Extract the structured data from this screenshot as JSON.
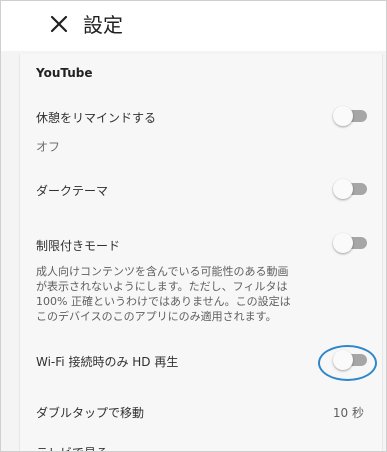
{
  "header": {
    "close_icon": "close-icon",
    "title": "設定"
  },
  "section": {
    "title": "YouTube"
  },
  "settings": {
    "remind_break": {
      "label": "休憩をリマインドする",
      "value": "オフ",
      "enabled": false
    },
    "dark_theme": {
      "label": "ダークテーマ",
      "enabled": false
    },
    "restricted_mode": {
      "label": "制限付きモード",
      "enabled": false,
      "description_lines": [
        "成人向けコンテンツを含んでいる可能性のある動画",
        "が表示されないようにします。ただし、フィルタは",
        "100% 正確というわけではありません。この設定は",
        "このデバイスのこのアプリにのみ適用されます。"
      ]
    },
    "wifi_hd": {
      "label": "Wi-Fi 接続時のみ HD 再生",
      "enabled": false,
      "highlighted": true
    },
    "double_tap": {
      "label": "ダブルタップで移動",
      "value": "10 秒"
    },
    "watch_tv": {
      "label": "テレビで見る"
    }
  },
  "colors": {
    "highlight": "#2f87c9",
    "toggle_track_off": "#a6a6a6",
    "toggle_knob": "#fafafa"
  }
}
